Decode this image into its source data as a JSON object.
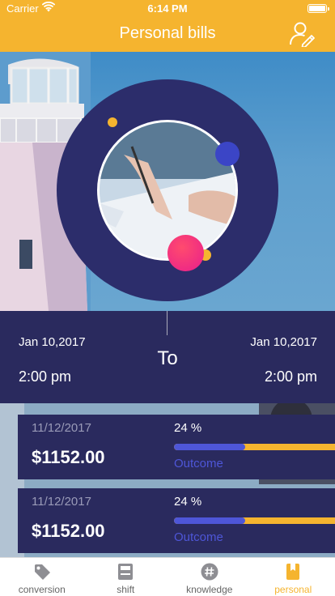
{
  "status_bar": {
    "carrier": "Carrier",
    "time": "6:14 PM"
  },
  "nav": {
    "title": "Personal bills"
  },
  "date_range": {
    "start_date": "Jan 10,2017",
    "start_time": "2:00 pm",
    "separator": "To",
    "end_date": "Jan 10,2017",
    "end_time": "2:00 pm"
  },
  "bills": [
    {
      "date": "11/12/2017",
      "amount": "$1152.00",
      "percent": "24 %",
      "progress": 0.44,
      "type": "Outcome"
    },
    {
      "date": "11/12/2017",
      "amount": "$1152.00",
      "percent": "24 %",
      "progress": 0.44,
      "type": "Outcome"
    }
  ],
  "tabs": [
    {
      "label": "conversion",
      "icon": "tag-icon"
    },
    {
      "label": "shift",
      "icon": "save-icon"
    },
    {
      "label": "knowledge",
      "icon": "hashtag-icon"
    },
    {
      "label": "personal",
      "icon": "bookmark-icon",
      "active": true
    }
  ],
  "colors": {
    "accent": "#f5b42f",
    "navy": "#2a2a5e",
    "blue": "#4e56d8"
  }
}
